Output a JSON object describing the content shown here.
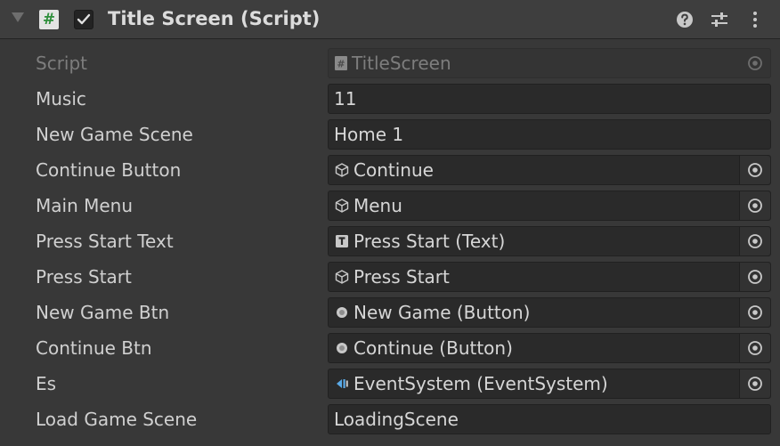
{
  "component": {
    "title": "Title Screen (Script)",
    "script_icon_glyph": "#",
    "enabled": true,
    "header_icons": [
      "help-icon",
      "preset-icon",
      "more-menu-icon"
    ]
  },
  "properties": [
    {
      "label": "Script",
      "value": "TitleScreen",
      "icon": "script-file-icon",
      "picker": true,
      "disabled": true
    },
    {
      "label": "Music",
      "value": "11",
      "icon": null,
      "picker": false,
      "disabled": false
    },
    {
      "label": "New Game Scene",
      "value": "Home 1",
      "icon": null,
      "picker": false,
      "disabled": false
    },
    {
      "label": "Continue Button",
      "value": "Continue",
      "icon": "gameobject-icon",
      "picker": true,
      "disabled": false
    },
    {
      "label": "Main Menu",
      "value": "Menu",
      "icon": "gameobject-icon",
      "picker": true,
      "disabled": false
    },
    {
      "label": "Press Start Text",
      "value": "Press Start (Text)",
      "icon": "text-component-icon",
      "picker": true,
      "disabled": false
    },
    {
      "label": "Press Start",
      "value": "Press Start",
      "icon": "gameobject-icon",
      "picker": true,
      "disabled": false
    },
    {
      "label": "New Game Btn",
      "value": "New Game (Button)",
      "icon": "button-component-icon",
      "picker": true,
      "disabled": false
    },
    {
      "label": "Continue Btn",
      "value": "Continue (Button)",
      "icon": "button-component-icon",
      "picker": true,
      "disabled": false
    },
    {
      "label": "Es",
      "value": "EventSystem (EventSystem)",
      "icon": "eventsystem-icon",
      "picker": true,
      "disabled": false
    },
    {
      "label": "Load Game Scene",
      "value": "LoadingScene",
      "icon": null,
      "picker": false,
      "disabled": false
    }
  ]
}
